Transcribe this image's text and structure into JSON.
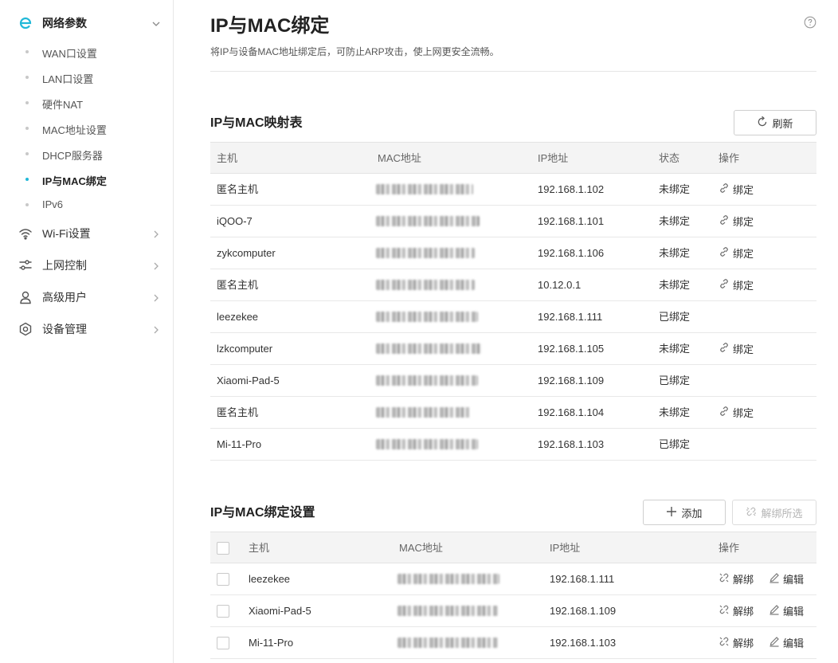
{
  "sidebar": {
    "network_group": {
      "label": "网络参数",
      "icon": "router-e-icon",
      "accent": "#20b8d8"
    },
    "sub_items": [
      {
        "label": "WAN口设置",
        "active": false
      },
      {
        "label": "LAN口设置",
        "active": false
      },
      {
        "label": "硬件NAT",
        "active": false
      },
      {
        "label": "MAC地址设置",
        "active": false
      },
      {
        "label": "DHCP服务器",
        "active": false
      },
      {
        "label": "IP与MAC绑定",
        "active": true
      },
      {
        "label": "IPv6",
        "active": false
      }
    ],
    "groups": [
      {
        "label": "Wi-Fi设置",
        "icon": "wifi-icon"
      },
      {
        "label": "上网控制",
        "icon": "sliders-icon"
      },
      {
        "label": "高级用户",
        "icon": "user-icon"
      },
      {
        "label": "设备管理",
        "icon": "gear-icon"
      }
    ]
  },
  "page": {
    "title": "IP与MAC绑定",
    "description": "将IP与设备MAC地址绑定后，可防止ARP攻击，使上网更安全流畅。"
  },
  "mapping": {
    "title": "IP与MAC映射表",
    "refresh_label": "刷新",
    "columns": [
      "主机",
      "MAC地址",
      "IP地址",
      "状态",
      "操作"
    ],
    "bind_label": "绑定",
    "rows": [
      {
        "host": "匿名主机",
        "ip": "192.168.1.102",
        "status": "未绑定",
        "can_bind": true
      },
      {
        "host": "iQOO-7",
        "ip": "192.168.1.101",
        "status": "未绑定",
        "can_bind": true
      },
      {
        "host": "zykcomputer",
        "ip": "192.168.1.106",
        "status": "未绑定",
        "can_bind": true
      },
      {
        "host": "匿名主机",
        "ip": "10.12.0.1",
        "status": "未绑定",
        "can_bind": true
      },
      {
        "host": "leezekee",
        "ip": "192.168.1.111",
        "status": "已绑定",
        "can_bind": false
      },
      {
        "host": "lzkcomputer",
        "ip": "192.168.1.105",
        "status": "未绑定",
        "can_bind": true
      },
      {
        "host": "Xiaomi-Pad-5",
        "ip": "192.168.1.109",
        "status": "已绑定",
        "can_bind": false
      },
      {
        "host": "匿名主机",
        "ip": "192.168.1.104",
        "status": "未绑定",
        "can_bind": true
      },
      {
        "host": "Mi-11-Pro",
        "ip": "192.168.1.103",
        "status": "已绑定",
        "can_bind": false
      }
    ]
  },
  "binding": {
    "title": "IP与MAC绑定设置",
    "add_label": "添加",
    "unbind_all_label": "解绑所选",
    "columns": [
      "主机",
      "MAC地址",
      "IP地址",
      "操作"
    ],
    "unbind_label": "解绑",
    "edit_label": "编辑",
    "rows": [
      {
        "host": "leezekee",
        "ip": "192.168.1.111"
      },
      {
        "host": "Xiaomi-Pad-5",
        "ip": "192.168.1.109"
      },
      {
        "host": "Mi-11-Pro",
        "ip": "192.168.1.103"
      }
    ]
  }
}
